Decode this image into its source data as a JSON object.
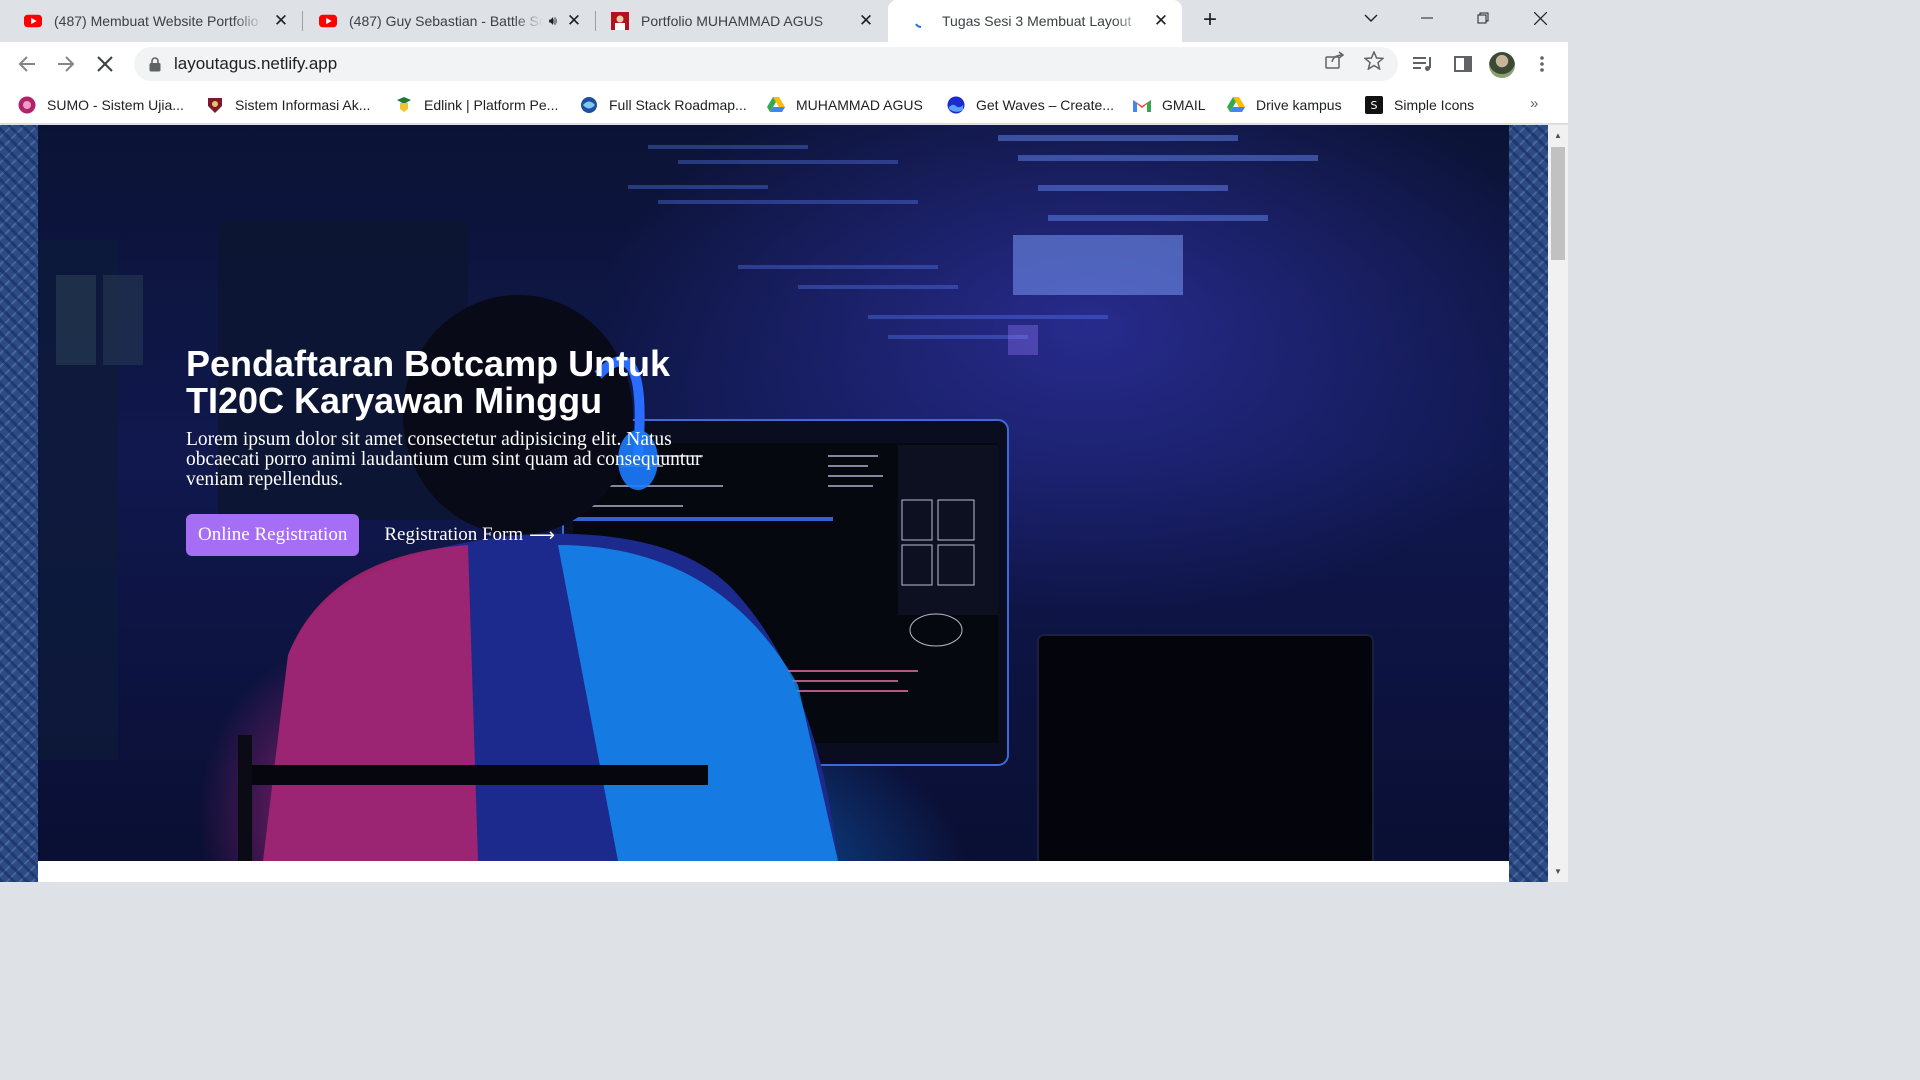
{
  "tabs": [
    {
      "title": "(487) Membuat Website Portfolio",
      "favicon": "youtube-icon",
      "audio": false
    },
    {
      "title": "(487) Guy Sebastian - Battle Scars",
      "favicon": "youtube-icon",
      "audio": true
    },
    {
      "title": "Portfolio MUHAMMAD AGUS",
      "favicon": "portrait-favicon",
      "audio": false
    },
    {
      "title": "Tugas Sesi 3 Membuat Layout",
      "favicon": "loading-spinner-icon",
      "audio": false,
      "active": true
    }
  ],
  "address_bar": {
    "url": "layoutagus.netlify.app"
  },
  "bookmarks": [
    {
      "label": "SUMO - Sistem Ujia...",
      "icon": "sumo-icon"
    },
    {
      "label": "Sistem Informasi Ak...",
      "icon": "campus-crest-icon"
    },
    {
      "label": "Edlink | Platform Pe...",
      "icon": "edlink-icon"
    },
    {
      "label": "Full Stack Roadmap...",
      "icon": "roadmap-icon"
    },
    {
      "label": "MUHAMMAD AGUS",
      "icon": "google-drive-icon"
    },
    {
      "label": "Get Waves – Create...",
      "icon": "waves-icon"
    },
    {
      "label": "GMAIL",
      "icon": "gmail-icon"
    },
    {
      "label": "Drive kampus",
      "icon": "google-drive-icon"
    },
    {
      "label": "Simple Icons",
      "icon": "simple-icons-icon"
    }
  ],
  "hero": {
    "title": "Pendaftaran Botcamp Untuk TI20C Karyawan Minggu",
    "description": "Lorem ipsum dolor sit amet consectetur adipisicing elit. Natus obcaecati porro animi laudantium cum sint quam ad consequuntur veniam repellendus.",
    "primary_button": "Online Registration",
    "secondary_link": "Registration Form",
    "secondary_arrow": "⟶"
  },
  "colors": {
    "primary_button": "#a56ef5",
    "tabstrip": "#dee1e6"
  }
}
